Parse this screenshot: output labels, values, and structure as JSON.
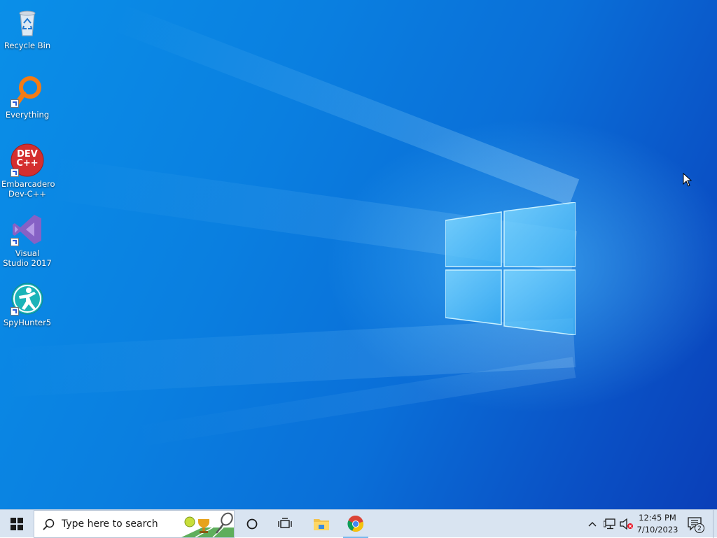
{
  "desktop": {
    "icons": [
      {
        "label": "Recycle Bin",
        "icon": "recycle-bin-icon"
      },
      {
        "label": "Everything",
        "icon": "everything-search-icon"
      },
      {
        "label": "Embarcadero Dev-C++",
        "icon": "dev-cpp-icon",
        "icon_text": "DEV C++"
      },
      {
        "label": "Visual Studio 2017",
        "icon": "visual-studio-icon"
      },
      {
        "label": "SpyHunter5",
        "icon": "spyhunter-icon"
      }
    ]
  },
  "taskbar": {
    "start": {
      "icon": "windows-start-icon"
    },
    "search": {
      "placeholder": "Type here to search",
      "icon": "search-icon"
    },
    "cortana": {
      "icon": "cortana-circle-icon"
    },
    "task_view": {
      "icon": "task-view-icon"
    },
    "pinned": [
      {
        "name": "File Explorer",
        "icon": "file-explorer-icon"
      },
      {
        "name": "Google Chrome",
        "icon": "chrome-icon"
      }
    ],
    "tray": {
      "time": "12:45 PM",
      "date": "7/10/2023",
      "notification_count": "2"
    }
  },
  "colors": {
    "desktop_blue": "#0a7fe0",
    "taskbar": "#d9e4f1"
  }
}
